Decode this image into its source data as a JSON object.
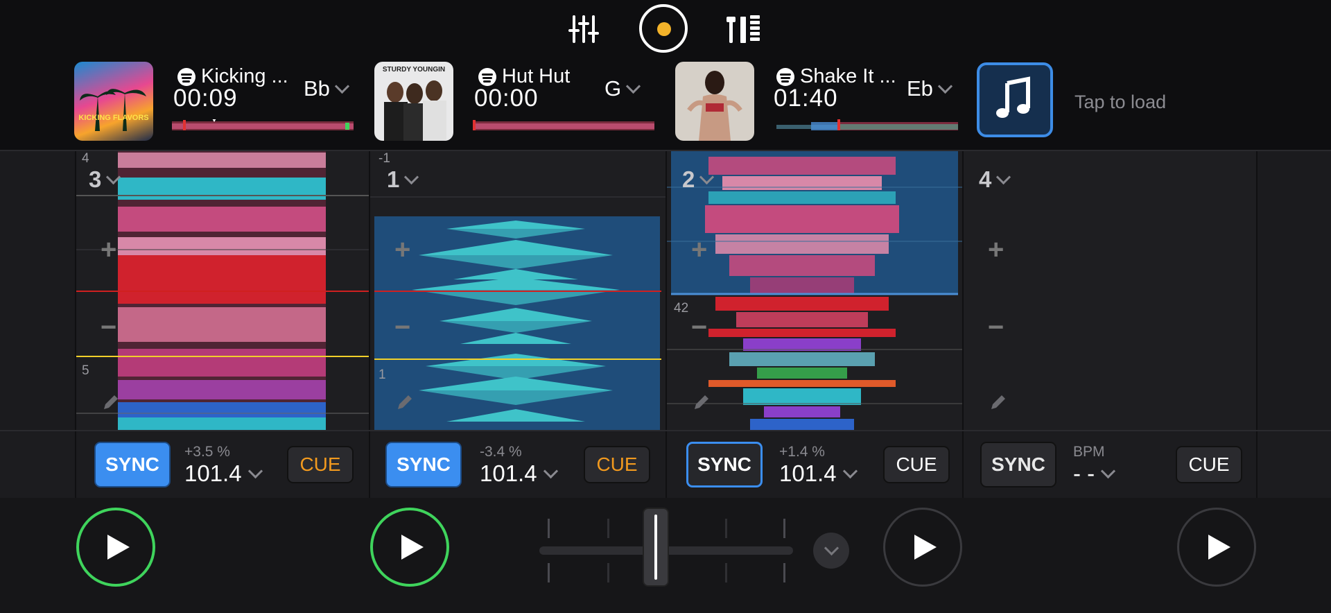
{
  "toolbar": {
    "icons": [
      "mixer-sliders-icon",
      "record-icon",
      "layout-icon"
    ],
    "record_color": "#f3b32a"
  },
  "decks": [
    {
      "id": 1,
      "title": "Kicking ...",
      "time": "00:09",
      "key": "Bb",
      "artwork_text": "KICKING FLAVORS",
      "deck_number": "3",
      "beat_top": "4",
      "beat_bottom": "5",
      "sync_label": "SYNC",
      "sync_state": "on",
      "pitch": "+3.5 %",
      "bpm": "101.4",
      "cue_label": "CUE",
      "cue_color": "orange",
      "playing": true
    },
    {
      "id": 2,
      "title": "Hut Hut",
      "time": "00:00",
      "key": "G",
      "artwork_text": "STURDY YOUNGIN",
      "deck_number": "1",
      "beat_top": "-1",
      "beat_bottom": "1",
      "sync_label": "SYNC",
      "sync_state": "on",
      "pitch": "-3.4 %",
      "bpm": "101.4",
      "cue_label": "CUE",
      "cue_color": "orange",
      "playing": true
    },
    {
      "id": 3,
      "title": "Shake It ...",
      "time": "01:40",
      "key": "Eb",
      "deck_number": "2",
      "beat_mid": "42",
      "sync_label": "SYNC",
      "sync_state": "outline",
      "pitch": "+1.4 %",
      "bpm": "101.4",
      "cue_label": "CUE",
      "cue_color": "white",
      "playing": false
    },
    {
      "id": 4,
      "deck_number": "4",
      "sync_label": "SYNC",
      "sync_state": "off",
      "pitch": "BPM",
      "bpm": "- -",
      "cue_label": "CUE",
      "cue_color": "white",
      "playing": false
    }
  ],
  "load": {
    "label": "Tap to load",
    "icon": "music-note-icon"
  },
  "colors": {
    "sync_blue": "#3b8ef0",
    "cue_orange": "#f29a1e",
    "play_green": "#3fd45c"
  }
}
